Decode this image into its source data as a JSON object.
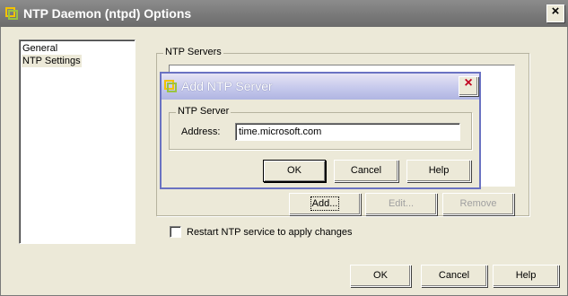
{
  "window": {
    "title": "NTP Daemon (ntpd) Options"
  },
  "nav": {
    "items": [
      {
        "label": "General",
        "selected": false
      },
      {
        "label": "NTP Settings",
        "selected": true
      }
    ]
  },
  "ntp_servers": {
    "group_label": "NTP Servers",
    "buttons": {
      "add": "Add...",
      "edit": "Edit...",
      "remove": "Remove"
    }
  },
  "restart": {
    "label": "Restart NTP service to apply changes",
    "checked": false
  },
  "footer": {
    "ok": "OK",
    "cancel": "Cancel",
    "help": "Help"
  },
  "dialog": {
    "title": "Add NTP Server",
    "group_label": "NTP Server",
    "address_label": "Address:",
    "address_value": "time.microsoft.com",
    "ok": "OK",
    "cancel": "Cancel",
    "help": "Help"
  },
  "colors": {
    "window_bg": "#ece9d8",
    "inactive_title": "#7b7b7b",
    "dialog_border": "#6a72c2",
    "dialog_close": "#c0001f"
  },
  "icons": {
    "app": "vmware-vsphere-icon",
    "close": "close-icon"
  }
}
